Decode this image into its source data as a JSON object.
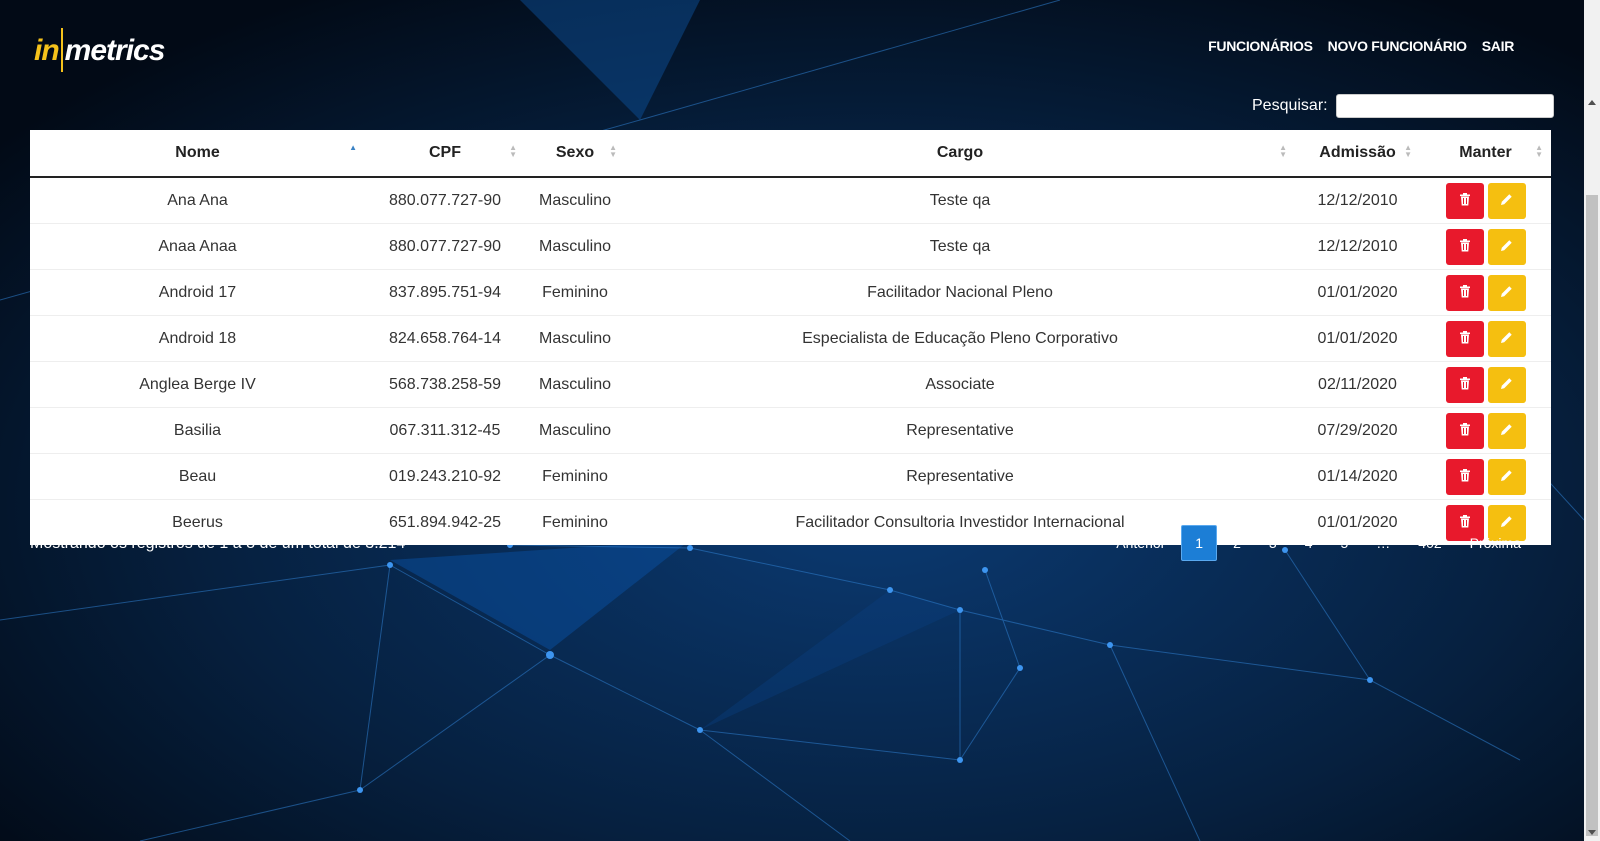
{
  "brand": {
    "part1": "in",
    "part2": "metrics",
    "accent": "#f5c21b"
  },
  "nav": {
    "funcionarios": "FUNCIONÁRIOS",
    "novo": "NOVO FUNCIONÁRIO",
    "sair": "SAIR"
  },
  "search": {
    "label": "Pesquisar:",
    "value": ""
  },
  "table": {
    "headers": [
      "Nome",
      "CPF",
      "Sexo",
      "Cargo",
      "Admissão",
      "Manter"
    ],
    "sorted_column": "Nome",
    "sort_direction": "asc",
    "rows": [
      {
        "nome": "Ana Ana",
        "cpf": "880.077.727-90",
        "sexo": "Masculino",
        "cargo": "Teste qa",
        "admissao": "12/12/2010"
      },
      {
        "nome": "Anaa Anaa",
        "cpf": "880.077.727-90",
        "sexo": "Masculino",
        "cargo": "Teste qa",
        "admissao": "12/12/2010"
      },
      {
        "nome": "Android 17",
        "cpf": "837.895.751-94",
        "sexo": "Feminino",
        "cargo": "Facilitador Nacional Pleno",
        "admissao": "01/01/2020"
      },
      {
        "nome": "Android 18",
        "cpf": "824.658.764-14",
        "sexo": "Masculino",
        "cargo": "Especialista de Educação Pleno Corporativo",
        "admissao": "01/01/2020"
      },
      {
        "nome": "Anglea Berge IV",
        "cpf": "568.738.258-59",
        "sexo": "Masculino",
        "cargo": "Associate",
        "admissao": "02/11/2020"
      },
      {
        "nome": "Basilia",
        "cpf": "067.311.312-45",
        "sexo": "Masculino",
        "cargo": "Representative",
        "admissao": "07/29/2020"
      },
      {
        "nome": "Beau",
        "cpf": "019.243.210-92",
        "sexo": "Feminino",
        "cargo": "Representative",
        "admissao": "01/14/2020"
      },
      {
        "nome": "Beerus",
        "cpf": "651.894.942-25",
        "sexo": "Feminino",
        "cargo": "Facilitador Consultoria Investidor Internacional",
        "admissao": "01/01/2020"
      }
    ],
    "icons": {
      "delete": "trash-icon",
      "edit": "pencil-icon"
    },
    "colors": {
      "delete": "#e8192c",
      "edit": "#f5bf10"
    }
  },
  "footer": {
    "info": "Mostrando os registros de 1 a 8 de um total de 3.214",
    "pagination": {
      "previous": "Anterior",
      "pages": [
        "1",
        "2",
        "3",
        "4",
        "5",
        "…",
        "402"
      ],
      "current": "1",
      "next": "Próxima"
    }
  }
}
